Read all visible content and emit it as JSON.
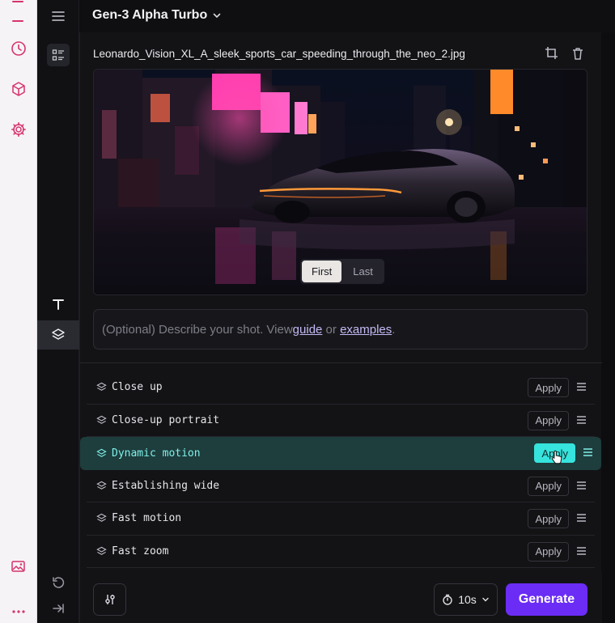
{
  "header": {
    "model_name": "Gen-3 Alpha Turbo"
  },
  "file": {
    "name": "Leonardo_Vision_XL_A_sleek_sports_car_speeding_through_the_neo_2.jpg"
  },
  "frame_toggle": {
    "first": "First",
    "last": "Last",
    "selected": "First"
  },
  "prompt": {
    "placeholder_start": "(Optional) Describe your shot. View ",
    "guide_link": "guide",
    "middle": " or ",
    "examples_link": "examples",
    "end": "."
  },
  "presets": [
    {
      "name": "Close up",
      "apply_label": "Apply",
      "highlighted": false
    },
    {
      "name": "Close-up portrait",
      "apply_label": "Apply",
      "highlighted": false
    },
    {
      "name": "Dynamic motion",
      "apply_label": "Apply",
      "highlighted": true
    },
    {
      "name": "Establishing wide",
      "apply_label": "Apply",
      "highlighted": false
    },
    {
      "name": "Fast motion",
      "apply_label": "Apply",
      "highlighted": false
    },
    {
      "name": "Fast zoom",
      "apply_label": "Apply",
      "highlighted": false
    }
  ],
  "footer": {
    "duration": "10s",
    "generate_label": "Generate"
  },
  "colors": {
    "accent": "#6b2cf5",
    "highlight": "#36e3dd",
    "rail_icon": "#d6336c"
  }
}
